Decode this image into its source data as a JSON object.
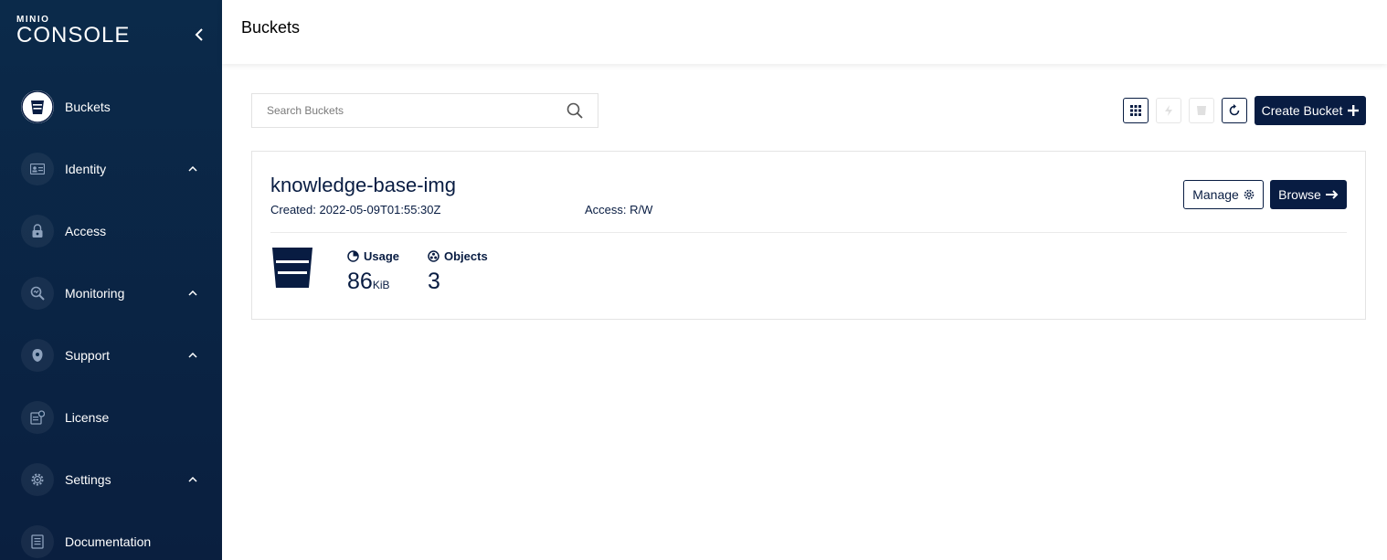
{
  "app": {
    "logo_small": "MINIO",
    "logo_big": "CONSOLE"
  },
  "sidebar": {
    "items": [
      {
        "label": "Buckets",
        "icon": "bucket-icon",
        "active": true,
        "expandable": false
      },
      {
        "label": "Identity",
        "icon": "id-card-icon",
        "active": false,
        "expandable": true
      },
      {
        "label": "Access",
        "icon": "lock-icon",
        "active": false,
        "expandable": false
      },
      {
        "label": "Monitoring",
        "icon": "magnifier-icon",
        "active": false,
        "expandable": true
      },
      {
        "label": "Support",
        "icon": "support-icon",
        "active": false,
        "expandable": true
      },
      {
        "label": "License",
        "icon": "license-icon",
        "active": false,
        "expandable": false
      },
      {
        "label": "Settings",
        "icon": "gear-icon",
        "active": false,
        "expandable": true
      },
      {
        "label": "Documentation",
        "icon": "document-icon",
        "active": false,
        "expandable": false
      }
    ]
  },
  "header": {
    "title": "Buckets"
  },
  "search": {
    "placeholder": "Search Buckets",
    "value": ""
  },
  "toolbar": {
    "create_label": "Create Bucket"
  },
  "buckets": [
    {
      "name": "knowledge-base-img",
      "created": "Created: 2022-05-09T01:55:30Z",
      "access": "Access: R/W",
      "manage_label": "Manage",
      "browse_label": "Browse",
      "usage_label": "Usage",
      "usage_value": "86",
      "usage_unit": "KiB",
      "objects_label": "Objects",
      "objects_value": "3"
    }
  ],
  "colors": {
    "primary": "#081c42",
    "sidebar_bg": "#0b2a4a"
  }
}
